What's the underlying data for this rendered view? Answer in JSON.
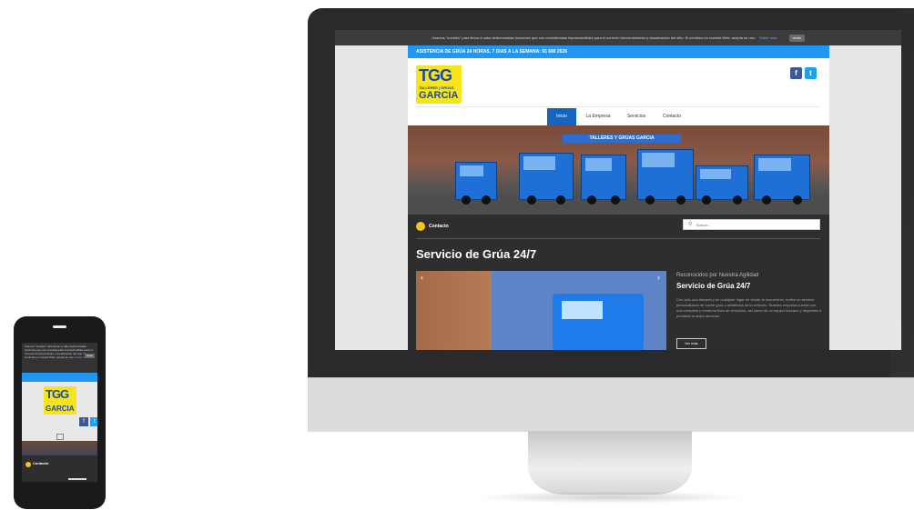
{
  "desktop": {
    "cookie": {
      "text": "Usamos \"cookies\" para llevar a cabo determinadas funciones que son consideradas imprescindibles para el correcto funcionamiento y visualización del sitio. Si continúa en nuestra Web, acepta su uso.",
      "more_link": "Saber más",
      "close_label": "close"
    },
    "topbar_text": "ASISTENCIA DE GRÚA 24 HORAS, 7 DIAS A LA SEMANA: 93 690 2626",
    "logo": {
      "main": "TGG",
      "sub": "TALLERES | GRÚAS",
      "name": "GARCIA"
    },
    "social": {
      "facebook": "f",
      "twitter": "t"
    },
    "nav": [
      "Inicio",
      "La Empresa",
      "Servicios",
      "Contacto"
    ],
    "hero_sign": "TALLERES Y GRÚAS GARCIA",
    "contact_label": "Contacto",
    "search_placeholder": "Buscar...",
    "section_title": "Servicio de Grúa 24/7",
    "slide": {
      "kicker": "Reconocidos por Nuestra Agilidad",
      "heading": "Servicio de Grúa 24/7",
      "body": "Con solo una llamada y en cualquier lugar en donde te encuentres, recibe un servicio personalizado de coche grúa o asistencia de la vehículo. Nuestra empresa cuenta con una completa y moderna flota de vehículos, así como de un equipo humano y dispuesto a prestarle la mejor atención.",
      "button": "Ver más",
      "prev_arrow": "‹",
      "next_arrow": "›"
    }
  },
  "mobile": {
    "cookie_text": "Usamos \"cookies\" para llevar a cabo determinadas funciones que son consideradas imprescindibles para el correcto funcionamiento y visualización del sitio. Si continúa en nuestra Web, acepta su uso.",
    "cookie_more": "Saber más",
    "cookie_close": "close",
    "logo_main": "TGG",
    "logo_name": "GARCIA",
    "facebook": "f",
    "twitter": "t",
    "contact_label": "Contacto"
  }
}
